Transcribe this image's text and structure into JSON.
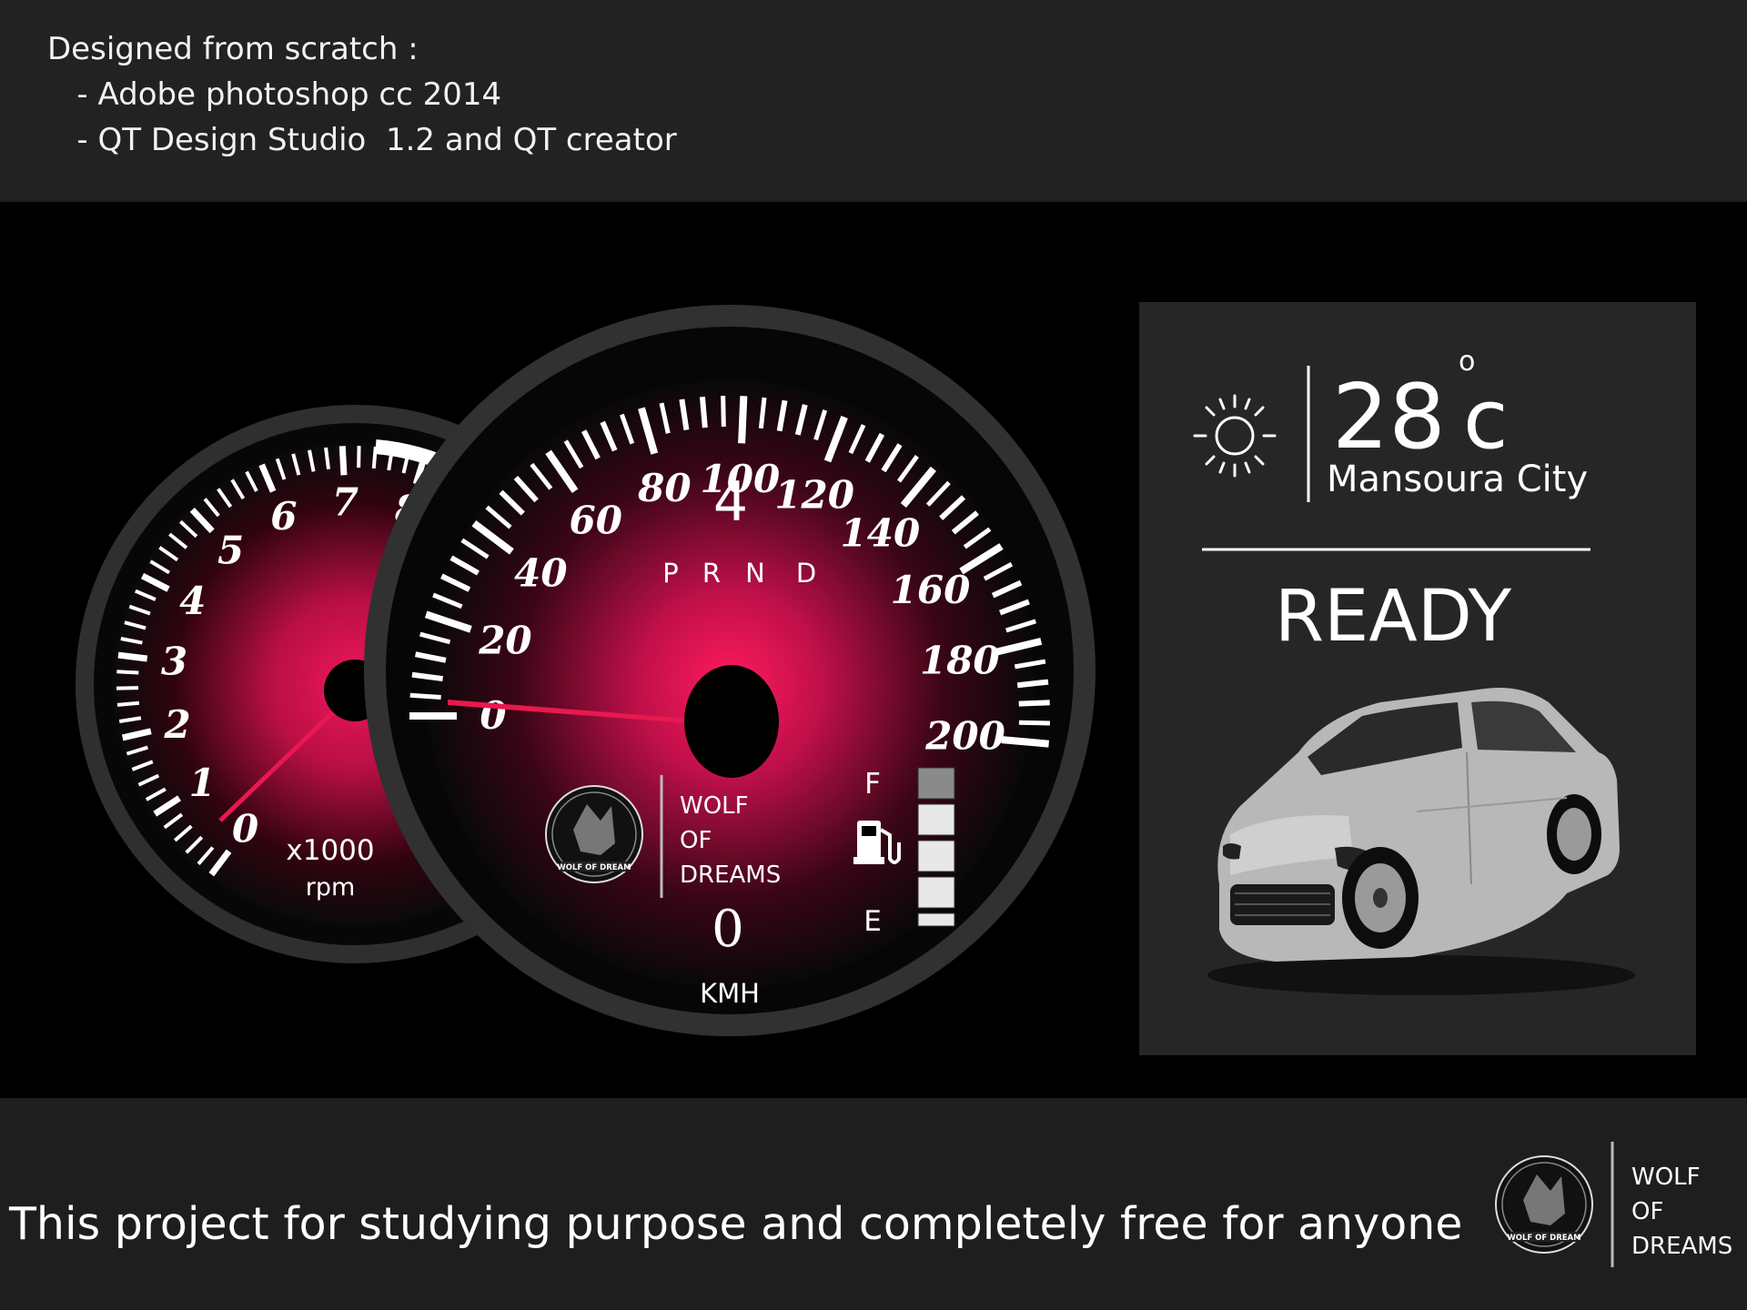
{
  "header": {
    "line1": "Designed from scratch :",
    "line2": "   - Adobe photoshop cc 2014",
    "line3": "   - QT Design Studio  1.2 and QT creator"
  },
  "tachometer": {
    "labels": [
      "0",
      "1",
      "2",
      "3",
      "4",
      "5",
      "6",
      "7",
      "8"
    ],
    "unit_line1": "x1000",
    "unit_line2": "rpm",
    "value": 0
  },
  "speedometer": {
    "labels": [
      "0",
      "20",
      "40",
      "60",
      "80",
      "100",
      "120",
      "140",
      "160",
      "180",
      "200"
    ],
    "gear": "4",
    "gear_letters": [
      "P",
      "R",
      "N",
      "D"
    ],
    "speed": "0",
    "unit": "KMH",
    "value": 0
  },
  "fuel": {
    "full_label": "F",
    "empty_label": "E",
    "level_fraction": 0.8,
    "icon": "fuel-pump-icon"
  },
  "brand": {
    "line1": "WOLF",
    "line2": "OF",
    "line3": "DREAMS",
    "logo_text": "WOLF OF DREAM"
  },
  "weather": {
    "icon": "sun-icon",
    "temperature": "28",
    "degree_symbol": "o",
    "unit": "c",
    "city": "Mansoura City"
  },
  "status": "READY",
  "footer": {
    "text": "This project for studying purpose and completely free for anyone",
    "brand_line1": "WOLF",
    "brand_line2": "OF",
    "brand_line3": "DREAMS",
    "logo_text": "WOLF OF DREAM"
  },
  "colors": {
    "accent": "#e8194f",
    "background": "#000000",
    "panel": "#262626"
  }
}
